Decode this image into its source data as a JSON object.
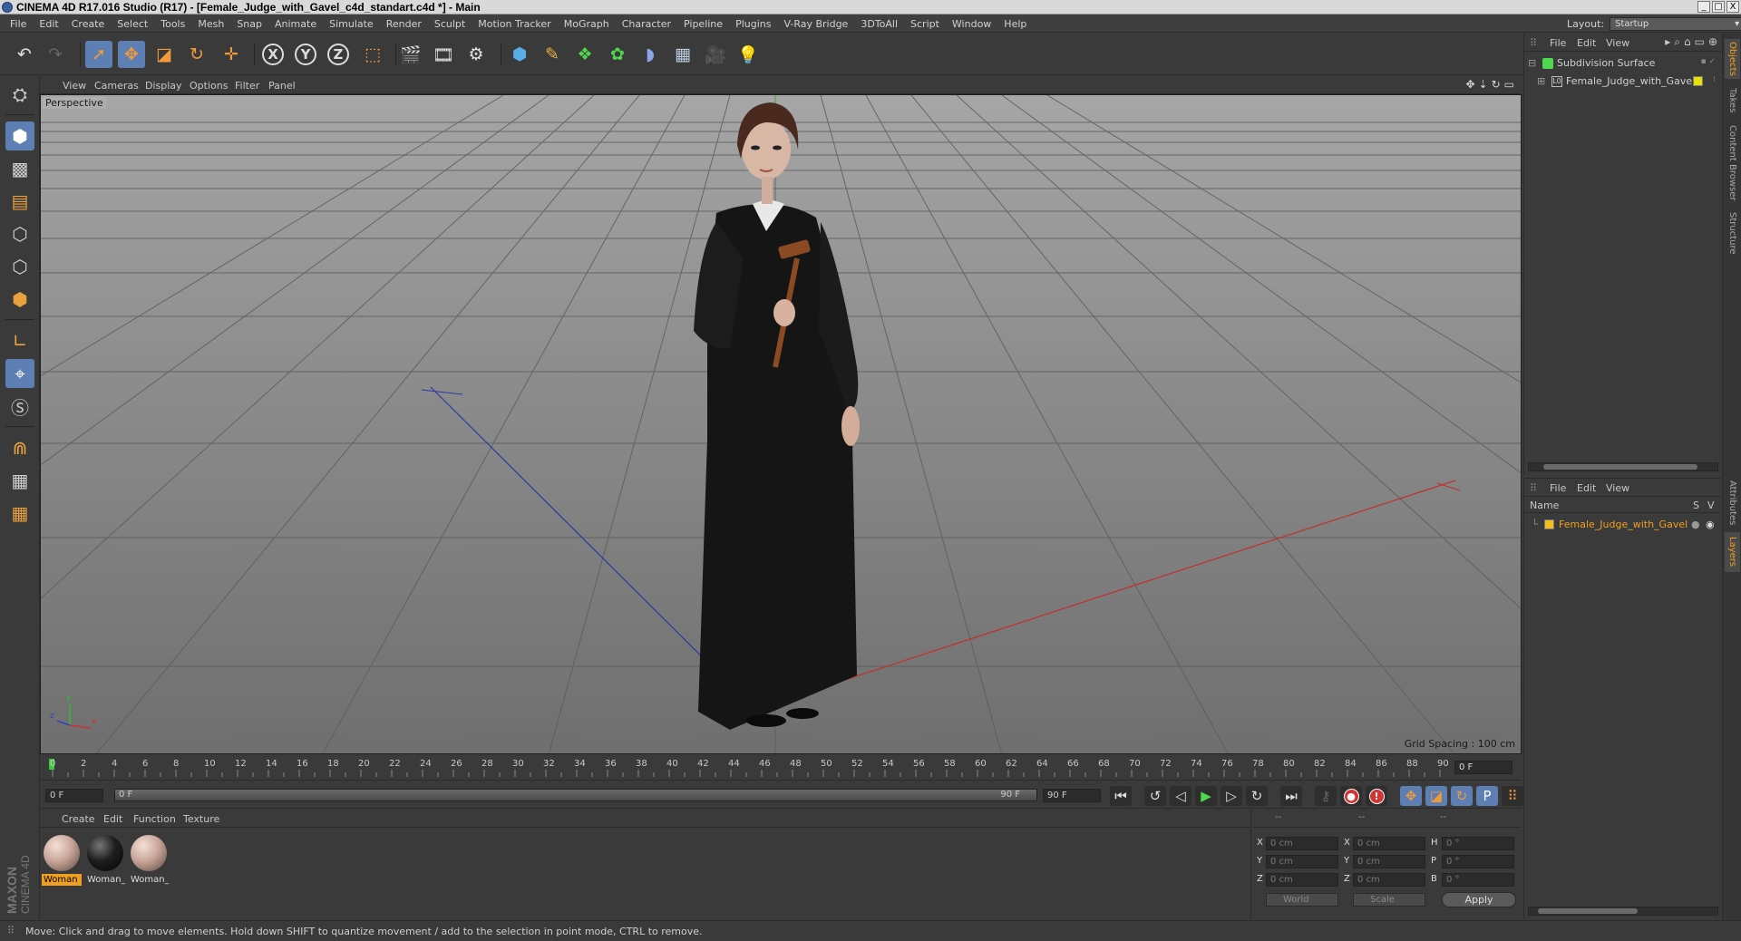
{
  "window": {
    "title": "CINEMA 4D R17.016 Studio (R17) - [Female_Judge_with_Gavel_c4d_standart.c4d *] - Main",
    "buttons": [
      "_",
      "□",
      "X"
    ]
  },
  "menubar": {
    "items": [
      "File",
      "Edit",
      "Create",
      "Select",
      "Tools",
      "Mesh",
      "Snap",
      "Animate",
      "Simulate",
      "Render",
      "Sculpt",
      "Motion Tracker",
      "MoGraph",
      "Character",
      "Pipeline",
      "Plugins",
      "V-Ray Bridge",
      "3DToAll",
      "Script",
      "Window",
      "Help"
    ],
    "layout_label": "Layout:",
    "layout_value": "Startup"
  },
  "toolbar": {
    "axis_x": "X",
    "axis_y": "Y",
    "axis_z": "Z"
  },
  "viewport": {
    "menu": [
      "View",
      "Cameras",
      "Display",
      "Options",
      "Filter",
      "Panel"
    ],
    "label": "Perspective",
    "grid_spacing": "Grid Spacing : 100 cm",
    "axis_labels": {
      "x": "x",
      "y": "y",
      "z": "z"
    }
  },
  "timeline": {
    "ticks": [
      "0",
      "2",
      "4",
      "6",
      "8",
      "10",
      "12",
      "14",
      "16",
      "18",
      "20",
      "22",
      "24",
      "26",
      "28",
      "30",
      "32",
      "34",
      "36",
      "38",
      "40",
      "42",
      "44",
      "46",
      "48",
      "50",
      "52",
      "54",
      "56",
      "58",
      "60",
      "62",
      "64",
      "66",
      "68",
      "70",
      "72",
      "74",
      "76",
      "78",
      "80",
      "82",
      "84",
      "86",
      "88",
      "90"
    ],
    "current_frame": "0 F"
  },
  "transport": {
    "start_field": "0 F",
    "slider_start": "0 F",
    "slider_end": "90 F",
    "end_field": "90 F",
    "record_label": "!",
    "keyframe_p": "P"
  },
  "materials": {
    "menu": [
      "Create",
      "Edit",
      "Function",
      "Texture"
    ],
    "items": [
      {
        "label": "Woman",
        "selected": true,
        "color": "#c9a69a"
      },
      {
        "label": "Woman_",
        "selected": false,
        "color": "#1e1e1e"
      },
      {
        "label": "Woman_",
        "selected": false,
        "color": "#c9a69a"
      }
    ]
  },
  "coordinates": {
    "headers": [
      "--",
      "--",
      "--"
    ],
    "rows": [
      {
        "l1": "X",
        "v1": "0 cm",
        "l2": "X",
        "v2": "0 cm",
        "l3": "H",
        "v3": "0 °"
      },
      {
        "l1": "Y",
        "v1": "0 cm",
        "l2": "Y",
        "v2": "0 cm",
        "l3": "P",
        "v3": "0 °"
      },
      {
        "l1": "Z",
        "v1": "0 cm",
        "l2": "Z",
        "v2": "0 cm",
        "l3": "B",
        "v3": "0 °"
      }
    ],
    "mode1": "World",
    "mode2": "Scale",
    "apply": "Apply"
  },
  "objects": {
    "menu": [
      "File",
      "Edit",
      "View"
    ],
    "items": [
      {
        "label": "Subdivision Surface"
      },
      {
        "label": "Female_Judge_with_Gavel"
      }
    ]
  },
  "layers": {
    "menu": [
      "File",
      "Edit",
      "View"
    ],
    "header_name": "Name",
    "header_s": "S",
    "header_v": "V",
    "items": [
      {
        "label": "Female_Judge_with_Gavel",
        "color": "#f0c020"
      }
    ]
  },
  "sidetabs": {
    "top": [
      "Objects",
      "Takes",
      "Content Browser",
      "Structure"
    ],
    "bottom": [
      "Attributes",
      "Layers"
    ]
  },
  "status": {
    "text": "Move: Click and drag to move elements. Hold down SHIFT to quantize movement / add to the selection in point mode, CTRL to remove."
  },
  "brand": {
    "maxon": "MAXON",
    "cinema": "CINEMA 4D"
  },
  "colors": {
    "accent": "#5d7fb3",
    "orange": "#f0a020",
    "panel": "#3a3a3a"
  }
}
